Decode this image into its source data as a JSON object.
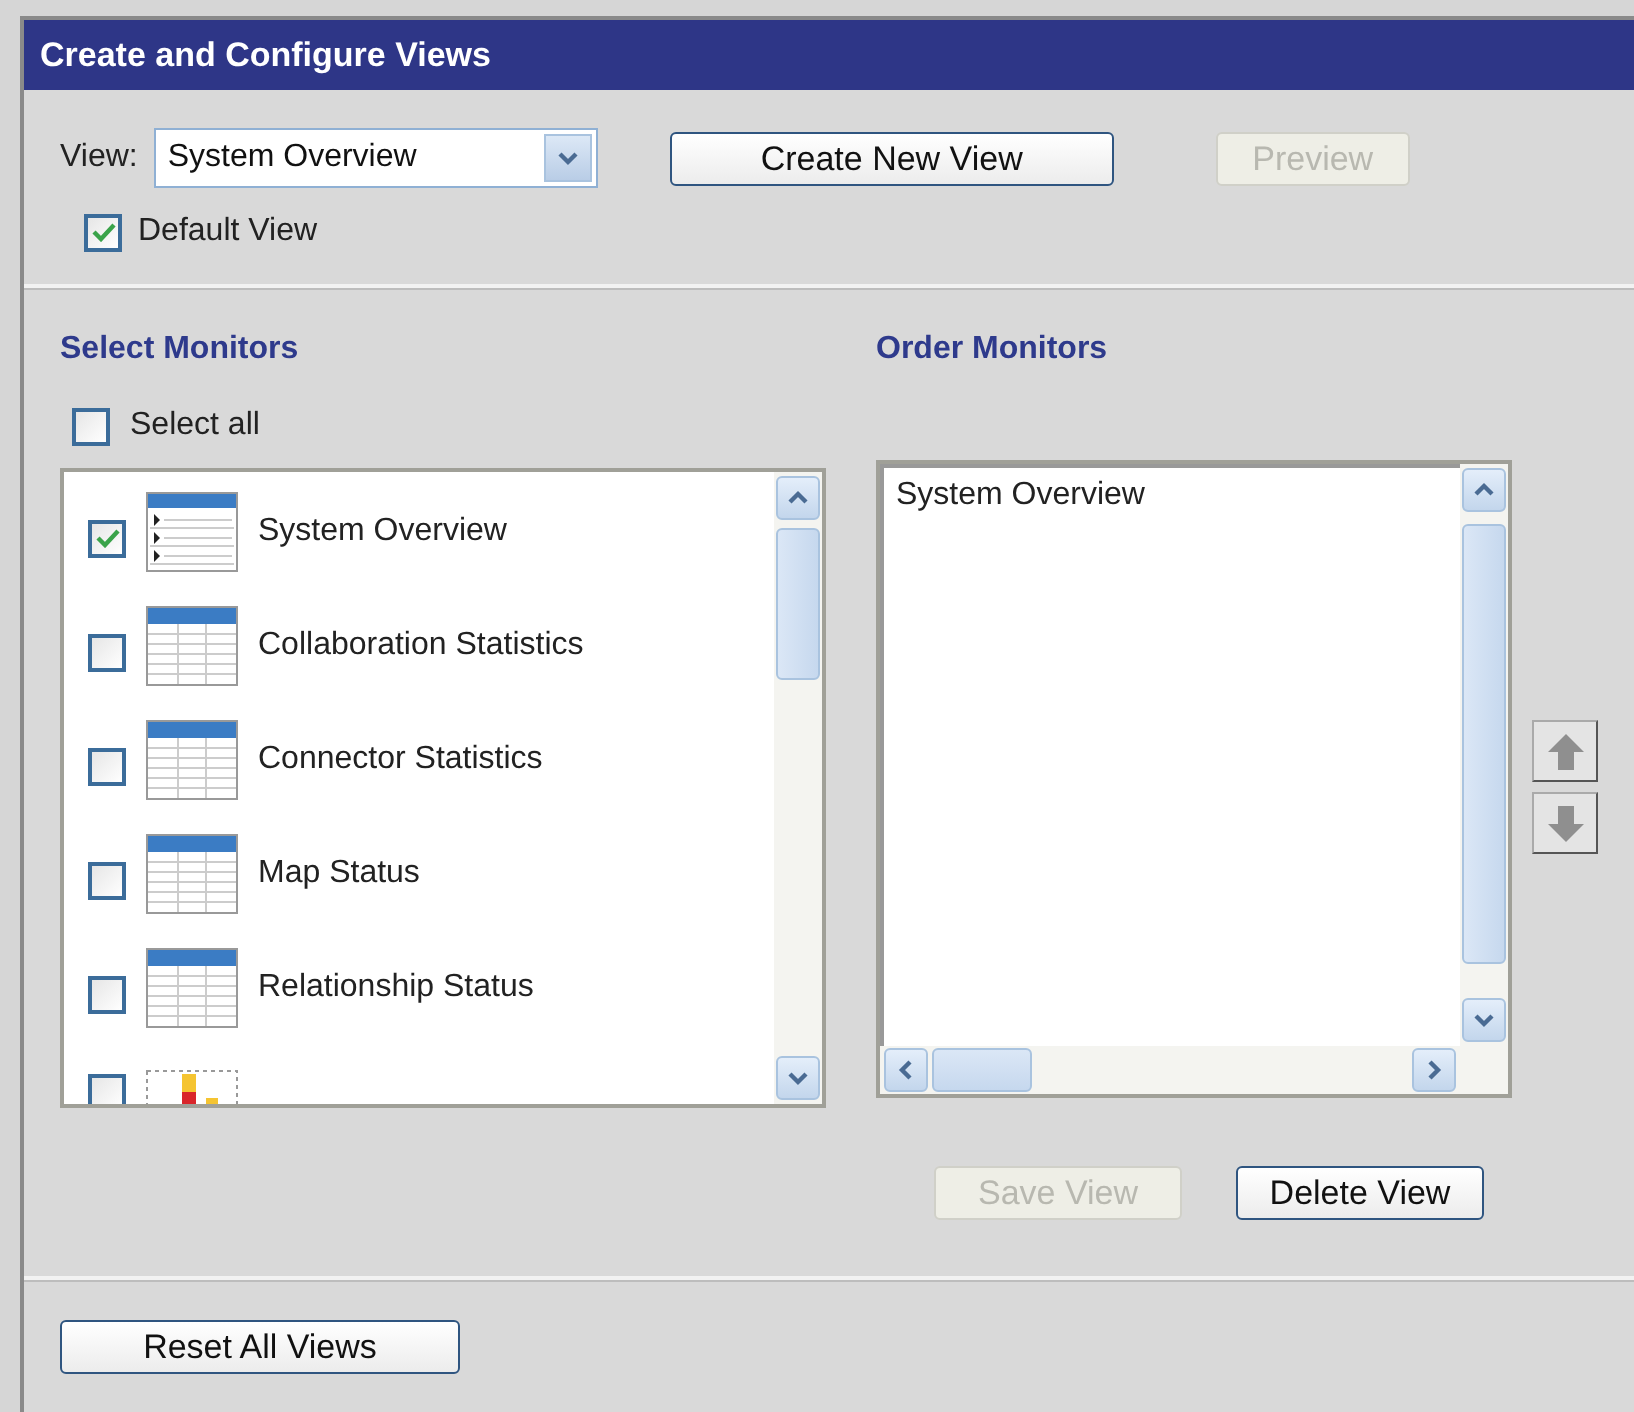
{
  "panel": {
    "title": "Create and Configure Views"
  },
  "view_select": {
    "label": "View:",
    "value": "System Overview"
  },
  "buttons": {
    "create": "Create New View",
    "preview": {
      "label": "Preview",
      "disabled": true
    }
  },
  "default_view": {
    "label": "Default View",
    "checked": true
  },
  "select_monitors": {
    "heading": "Select Monitors",
    "select_all": {
      "label": "Select all",
      "checked": false
    },
    "items": [
      {
        "label": "System Overview",
        "checked": true,
        "kind": "list"
      },
      {
        "label": "Collaboration Statistics",
        "checked": false,
        "kind": "table"
      },
      {
        "label": "Connector Statistics",
        "checked": false,
        "kind": "table"
      },
      {
        "label": "Map Status",
        "checked": false,
        "kind": "table"
      },
      {
        "label": "Relationship Status",
        "checked": false,
        "kind": "table"
      },
      {
        "checked": false,
        "kind": "chart"
      }
    ]
  },
  "order_monitors": {
    "heading": "Order Monitors",
    "items": [
      "System Overview"
    ]
  },
  "actions": [
    {
      "label": "Save View",
      "disabled": true
    },
    {
      "label": "Delete View",
      "disabled": false
    }
  ],
  "reset": {
    "label": "Reset All Views"
  }
}
